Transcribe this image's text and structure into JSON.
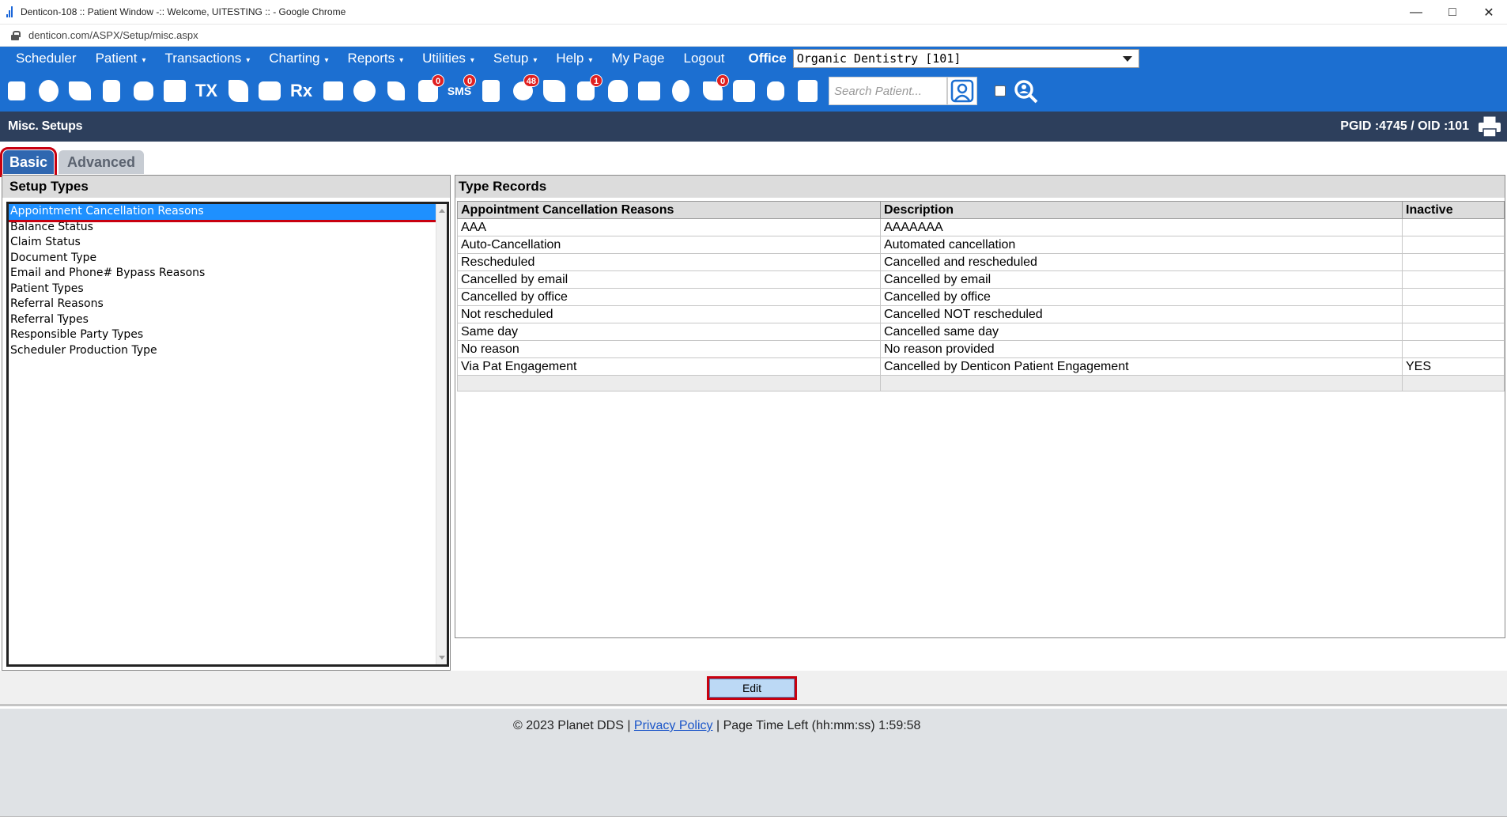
{
  "browser": {
    "window_title": "Denticon-108 :: Patient Window -:: Welcome, UITESTING :: - Google Chrome",
    "url": "denticon.com/ASPX/Setup/misc.aspx"
  },
  "menu": {
    "items": [
      {
        "label": "Scheduler",
        "has_dropdown": false
      },
      {
        "label": "Patient",
        "has_dropdown": true
      },
      {
        "label": "Transactions",
        "has_dropdown": true
      },
      {
        "label": "Charting",
        "has_dropdown": true
      },
      {
        "label": "Reports",
        "has_dropdown": true
      },
      {
        "label": "Utilities",
        "has_dropdown": true
      },
      {
        "label": "Setup",
        "has_dropdown": true
      },
      {
        "label": "Help",
        "has_dropdown": true
      },
      {
        "label": "My Page",
        "has_dropdown": false
      },
      {
        "label": "Logout",
        "has_dropdown": false
      }
    ],
    "office_label": "Office",
    "office_value": "Organic Dentistry [101]"
  },
  "toolbar": {
    "icons": [
      {
        "name": "calendar-icon"
      },
      {
        "name": "home-icon"
      },
      {
        "name": "dollar-icon"
      },
      {
        "name": "edit-chart-icon"
      },
      {
        "name": "tooth-icon"
      },
      {
        "name": "teeth-icon"
      },
      {
        "name": "tx-icon",
        "text": "TX"
      },
      {
        "name": "add-patient-icon"
      },
      {
        "name": "add-family-icon"
      },
      {
        "name": "rx-icon",
        "text": "Rx"
      },
      {
        "name": "notes-icon"
      },
      {
        "name": "document-icon"
      },
      {
        "name": "mail-icon"
      },
      {
        "name": "message-icon",
        "badge": "0"
      },
      {
        "name": "sms-icon",
        "text": "SMS",
        "badge": "0"
      },
      {
        "name": "clock-icon"
      },
      {
        "name": "globe-users-icon",
        "badge": "48"
      },
      {
        "name": "support-icon"
      },
      {
        "name": "refresh-patient-icon",
        "badge": "1"
      },
      {
        "name": "tooth-outline-icon"
      },
      {
        "name": "tooth-question-icon"
      },
      {
        "name": "globe-settings-icon"
      },
      {
        "name": "checklist-icon",
        "badge": "0"
      },
      {
        "name": "group-icon"
      },
      {
        "name": "printer-icon"
      },
      {
        "name": "collapse-icon"
      }
    ],
    "search_placeholder": "Search Patient..."
  },
  "page": {
    "title": "Misc. Setups",
    "ids": "PGID :4745  /  OID :101"
  },
  "tabs": [
    {
      "label": "Basic",
      "active": true
    },
    {
      "label": "Advanced",
      "active": false
    }
  ],
  "setup_types": {
    "header": "Setup Types",
    "items": [
      "Appointment Cancellation Reasons",
      "Balance Status",
      "Claim Status",
      "Document Type",
      "Email and Phone# Bypass Reasons",
      "Patient Types",
      "Referral Reasons",
      "Referral Types",
      "Responsible Party Types",
      "Scheduler Production Type"
    ],
    "selected_index": 0
  },
  "type_records": {
    "header": "Type Records",
    "columns": [
      "Appointment Cancellation Reasons",
      "Description",
      "Inactive"
    ],
    "rows": [
      [
        "AAA",
        "AAAAAAA",
        ""
      ],
      [
        "Auto-Cancellation",
        "Automated cancellation",
        ""
      ],
      [
        "Rescheduled",
        "Cancelled and rescheduled",
        ""
      ],
      [
        "Cancelled by email",
        "Cancelled by email",
        ""
      ],
      [
        "Cancelled by office",
        "Cancelled by office",
        ""
      ],
      [
        "Not rescheduled",
        "Cancelled NOT rescheduled",
        ""
      ],
      [
        "Same day",
        "Cancelled same day",
        ""
      ],
      [
        "No reason",
        "No reason provided",
        ""
      ],
      [
        "Via Pat Engagement",
        "Cancelled by Denticon Patient Engagement",
        "YES"
      ]
    ]
  },
  "actions": {
    "edit_label": "Edit"
  },
  "footer": {
    "copyright": "© 2023 Planet DDS |",
    "privacy_label": "Privacy Policy",
    "separator": "|",
    "time_left": "Page Time Left (hh:mm:ss) 1:59:58"
  },
  "colors": {
    "menu_bar": "#1c6fd1",
    "header_bar": "#2d3f5c",
    "selection": "#1e90ff",
    "highlight_outline": "#c8000f",
    "badge": "#e02020"
  }
}
